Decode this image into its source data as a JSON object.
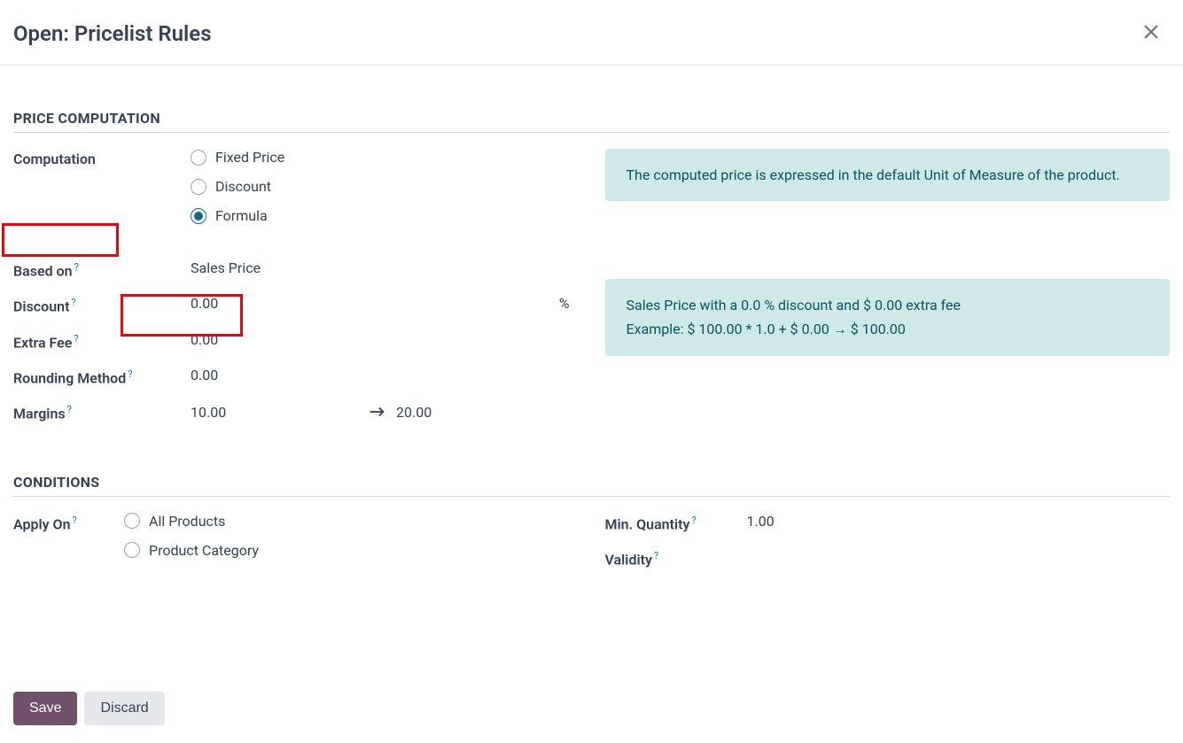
{
  "header": {
    "title": "Open: Pricelist Rules"
  },
  "sections": {
    "price_computation": "PRICE COMPUTATION",
    "conditions": "CONDITIONS"
  },
  "labels": {
    "computation": "Computation",
    "based_on": "Based on",
    "discount": "Discount",
    "extra_fee": "Extra Fee",
    "rounding_method": "Rounding Method",
    "margins": "Margins",
    "apply_on": "Apply On",
    "min_quantity": "Min. Quantity",
    "validity": "Validity"
  },
  "computation": {
    "options": {
      "fixed_price": "Fixed Price",
      "discount": "Discount",
      "formula": "Formula"
    },
    "selected": "formula"
  },
  "values": {
    "based_on": "Sales Price",
    "discount": "0.00",
    "discount_unit": "%",
    "extra_fee": "0.00",
    "rounding_method": "0.00",
    "margin_min": "10.00",
    "margin_max": "20.00",
    "min_quantity": "1.00"
  },
  "apply_on": {
    "options": {
      "all_products": "All Products",
      "product_category": "Product Category"
    }
  },
  "info": {
    "uom_note": "The computed price is expressed in the default Unit of Measure of the product.",
    "formula_line1": "Sales Price with a 0.0 % discount and $ 0.00 extra fee",
    "formula_line2": "Example: $ 100.00 * 1.0 + $ 0.00 → $ 100.00"
  },
  "footer": {
    "save": "Save",
    "discard": "Discard"
  },
  "help": "?"
}
